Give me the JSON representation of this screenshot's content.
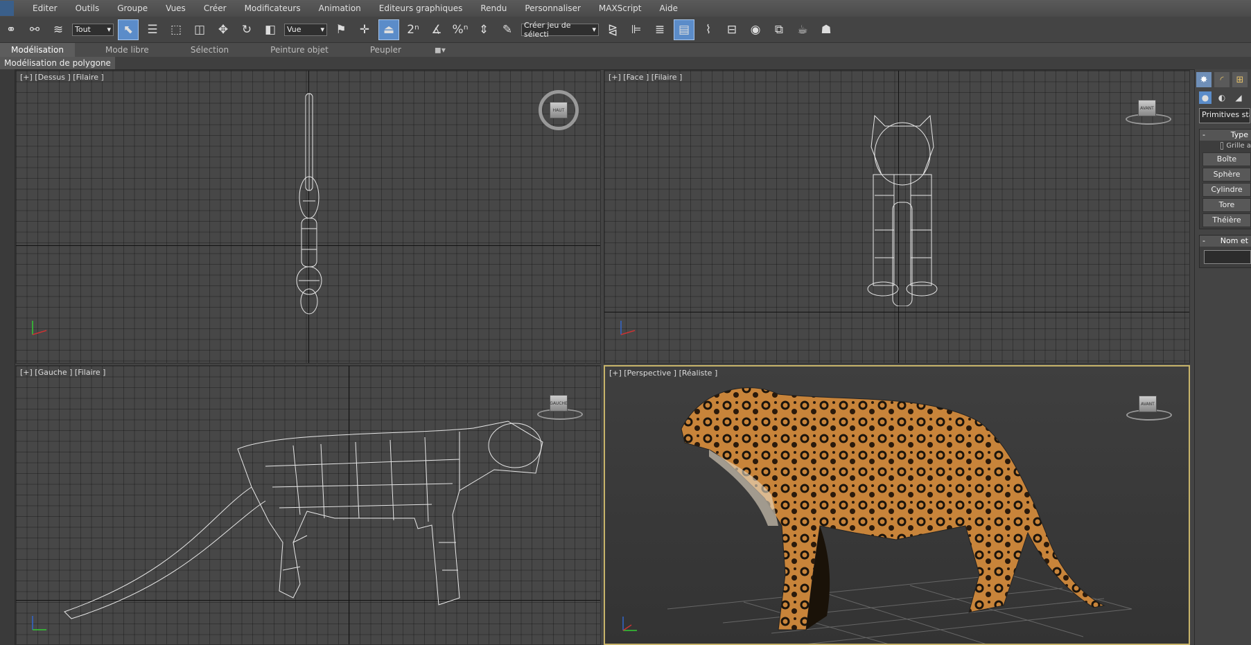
{
  "menu": {
    "items": [
      "Editer",
      "Outils",
      "Groupe",
      "Vues",
      "Créer",
      "Modificateurs",
      "Animation",
      "Editeurs graphiques",
      "Rendu",
      "Personnaliser",
      "MAXScript",
      "Aide"
    ]
  },
  "toolbar": {
    "selection_filter": "Tout",
    "reference_coord": "Vue",
    "named_selection_placeholder": "Créer jeu de sélecti",
    "snap_labels": [
      "2",
      "%"
    ]
  },
  "ribbon_tabs": {
    "items": [
      "Modélisation",
      "Mode libre",
      "Sélection",
      "Peinture objet",
      "Peupler"
    ],
    "active": "Modélisation"
  },
  "ribbon": {
    "panel_label": "Modélisation de polygone"
  },
  "viewports": {
    "top": {
      "label": "[+] [Dessus ] [Filaire ]",
      "cube_label": "HAUT"
    },
    "front": {
      "label": "[+] [Face ] [Filaire ]",
      "cube_label": "AVANT"
    },
    "left": {
      "label": "[+] [Gauche ] [Filaire ]",
      "cube_label": "GAUCHE"
    },
    "perspective": {
      "label": "[+] [Perspective ] [Réaliste ]",
      "cube_label": "AVANT"
    }
  },
  "command_panel": {
    "dropdown": "Primitives standard",
    "type_rollout": {
      "title": "Type",
      "grid_checkbox_label": "Grille a",
      "buttons": [
        "Boîte",
        "Sphère",
        "Cylindre",
        "Tore",
        "Théière"
      ]
    },
    "name_rollout": {
      "title": "Nom et"
    }
  },
  "colors": {
    "active_viewport_border": "#c8b46a",
    "active_tool": "#5b8cc9",
    "jaguar_fur": "#c8843a"
  }
}
